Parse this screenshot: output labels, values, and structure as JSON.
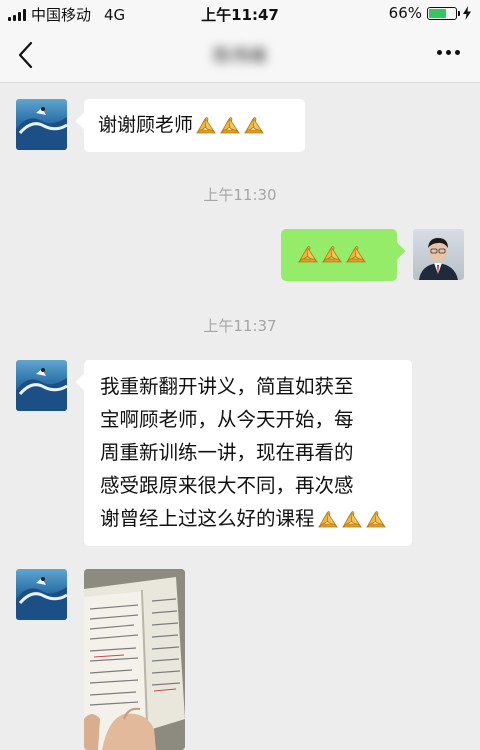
{
  "status_bar": {
    "carrier": "中国移动",
    "network": "4G",
    "time": "上午11:47",
    "battery_percent": "66%",
    "battery_level": 0.66
  },
  "nav": {
    "contact_name": "陈伟峰",
    "back_icon": "chevron-left-icon",
    "more_icon": "more-dots-icon"
  },
  "messages": [
    {
      "side": "left",
      "type": "text",
      "text": "谢谢顾老师",
      "emoji_count": 3,
      "emoji": "folded-hands-icon"
    },
    {
      "type": "timestamp",
      "text": "上午11:30"
    },
    {
      "side": "right",
      "type": "emoji",
      "emoji_count": 3,
      "emoji": "folded-hands-icon"
    },
    {
      "type": "timestamp",
      "text": "上午11:37"
    },
    {
      "side": "left",
      "type": "text",
      "lines": [
        "我重新翻开讲义，简直如获至",
        "宝啊顾老师，从今天开始，每",
        "周重新训练一讲，现在再看的",
        "感受跟原来很大不同，再次感",
        "谢曾经上过这么好的课程"
      ],
      "emoji_count": 3,
      "emoji": "folded-hands-icon"
    },
    {
      "side": "left",
      "type": "image"
    }
  ],
  "colors": {
    "background": "#ededed",
    "bubble_self": "#95ec69",
    "bubble_other": "#ffffff",
    "emoji": "#f2b53b",
    "battery": "#34c759"
  }
}
